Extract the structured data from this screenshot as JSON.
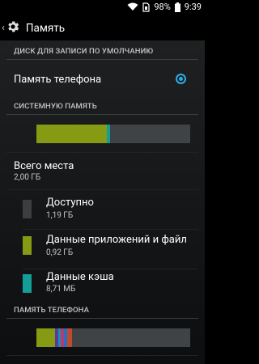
{
  "status_bar": {
    "battery": "98%",
    "time": "9:39",
    "icons": [
      "wifi-icon",
      "sim-icon",
      "battery-icon"
    ]
  },
  "header": {
    "title": "Память",
    "icons": [
      "back-chevron-icon",
      "settings-gear-icon"
    ]
  },
  "sections": {
    "default_disk": {
      "header": "ДИСК ДЛЯ ЗАПИСИ ПО УМОЛЧАНИЮ",
      "option_label": "Память телефона",
      "selected": true
    },
    "system_memory": {
      "header": "СИСТЕМНУЮ ПАМЯТЬ",
      "total_label": "Всего места",
      "total_value": "2,00 ГБ",
      "items": [
        {
          "label": "Доступно",
          "value": "1,19 ГБ",
          "color": "#3e3e3e"
        },
        {
          "label": "Данные приложений и файлы",
          "value": "0,92 ГБ",
          "color": "#869a13"
        },
        {
          "label": "Данные кэша",
          "value": "8,71 МБ",
          "color": "#149e98"
        }
      ],
      "usage_bar": [
        {
          "name": "apps",
          "fraction": 0.46,
          "color": "#869a13"
        },
        {
          "name": "cache",
          "fraction": 0.02,
          "color": "#149e98"
        }
      ]
    },
    "phone_memory": {
      "header": "ПАМЯТЬ ТЕЛЕФОНА",
      "usage_bar": [
        {
          "name": "seg1",
          "fraction": 0.12,
          "color": "#869a13"
        },
        {
          "name": "seg2",
          "fraction": 0.02,
          "color": "#5b3aa0"
        },
        {
          "name": "seg3",
          "fraction": 0.02,
          "color": "#1b8fb0"
        },
        {
          "name": "seg4",
          "fraction": 0.02,
          "color": "#b43a76"
        },
        {
          "name": "seg5",
          "fraction": 0.02,
          "color": "#2a6fbf"
        },
        {
          "name": "seg6",
          "fraction": 0.03,
          "color": "#c14a2a"
        }
      ]
    }
  }
}
